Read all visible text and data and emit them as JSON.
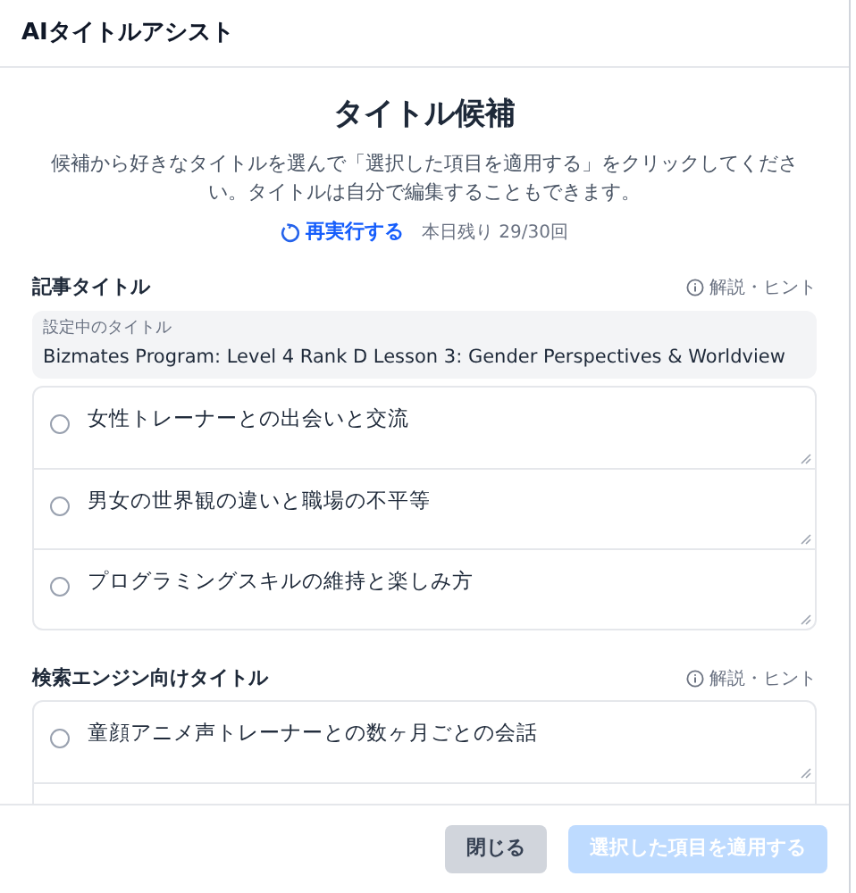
{
  "header": {
    "title": "AIタイトルアシスト"
  },
  "heading": "タイトル候補",
  "description": "候補から好きなタイトルを選んで「選択した項目を適用する」をクリックしてください。タイトルは自分で編集することもできます。",
  "rerun": {
    "label": "再実行する",
    "remaining": "本日残り 29/30回"
  },
  "sections": [
    {
      "title": "記事タイトル",
      "hint": "解説・ヒント",
      "current": {
        "label": "設定中のタイトル",
        "value": "Bizmates Program: Level 4 Rank D Lesson 3: Gender Perspectives & Worldview"
      },
      "options": [
        {
          "text": "女性トレーナーとの出会いと交流",
          "selected": false
        },
        {
          "text": "男女の世界観の違いと職場の不平等",
          "selected": false
        },
        {
          "text": "プログラミングスキルの維持と楽しみ方",
          "selected": false
        }
      ]
    },
    {
      "title": "検索エンジン向けタイトル",
      "hint": "解説・ヒント",
      "options": [
        {
          "text": "童顔アニメ声トレーナーとの数ヶ月ごとの会話",
          "selected": false
        }
      ]
    }
  ],
  "footer": {
    "close": "閉じる",
    "apply": {
      "label": "選択した項目を適用する",
      "disabled": true
    }
  }
}
